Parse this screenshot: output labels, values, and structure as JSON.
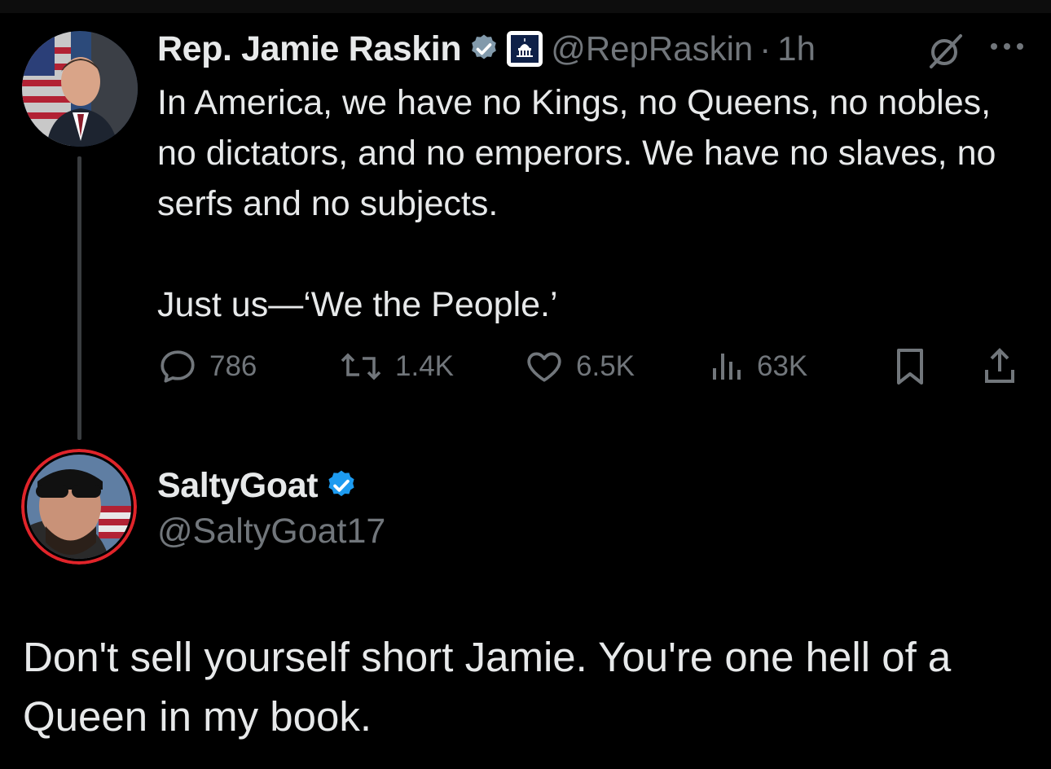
{
  "tweet1": {
    "display_name": "Rep. Jamie Raskin",
    "handle": "@RepRaskin",
    "separator": "·",
    "time": "1h",
    "body": [
      "In America, we have no Kings, no Queens, no nobles, no dictators, and no emperors. We have no slaves, no serfs and no subjects.",
      "Just us—‘We the People.’"
    ],
    "stats": {
      "replies": "786",
      "reposts": "1.4K",
      "likes": "6.5K",
      "views": "63K"
    },
    "icons": [
      "verified-badge-icon",
      "capitol-org-badge-icon",
      "grok-icon",
      "more-icon",
      "reply-icon",
      "repost-icon",
      "like-icon",
      "views-icon",
      "bookmark-icon",
      "share-icon"
    ]
  },
  "tweet2": {
    "display_name": "SaltyGoat",
    "handle": "@SaltyGoat17",
    "body": "Don't sell yourself short Jamie.  You're one hell of a Queen in my book."
  },
  "colors": {
    "background": "#000000",
    "text": "#e7e9ea",
    "secondary": "#71767b",
    "verified": "#1d9bf0",
    "avatar_ring": "#e0242a"
  }
}
